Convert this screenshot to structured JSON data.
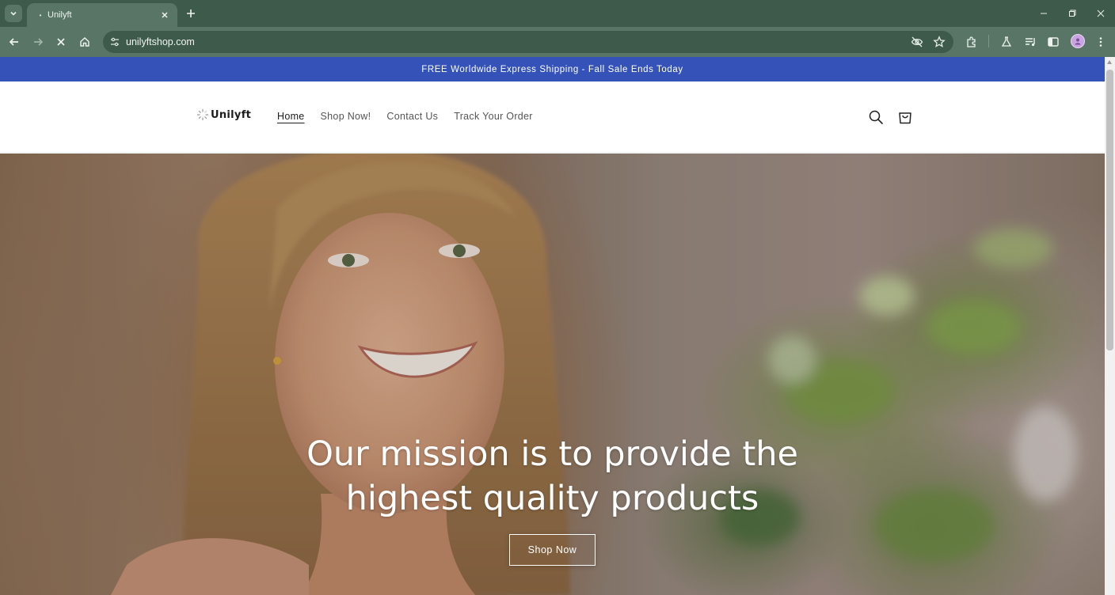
{
  "browser": {
    "tab_title": "Unilyft",
    "url": "unilyftshop.com",
    "icons": {
      "tab_search": "chevron-down-icon",
      "tab_close": "close-icon",
      "new_tab": "plus-icon",
      "back": "arrow-left-icon",
      "forward": "arrow-right-icon",
      "stop": "close-icon",
      "home": "home-icon",
      "site_info": "tune-icon",
      "eye_off": "eye-off-icon",
      "bookmark": "star-icon",
      "extensions": "puzzle-icon",
      "labs": "flask-icon",
      "media": "playlist-icon",
      "side_panel": "side-panel-icon",
      "menu": "kebab-icon"
    },
    "colors": {
      "frame": "#3d5a4a",
      "toolbar": "#587565"
    }
  },
  "page": {
    "announcement": "FREE Worldwide Express Shipping - Fall Sale Ends Today",
    "announcement_bg": "#3552b8",
    "logo_text": "Unilyft",
    "nav": [
      {
        "label": "Home",
        "active": true
      },
      {
        "label": "Shop Now!",
        "active": false
      },
      {
        "label": "Contact Us",
        "active": false
      },
      {
        "label": "Track Your Order",
        "active": false
      }
    ],
    "header_icons": [
      "search-icon",
      "cart-icon"
    ],
    "hero": {
      "title": "Our mission is to provide the highest quality products",
      "button_label": "Shop Now"
    }
  }
}
